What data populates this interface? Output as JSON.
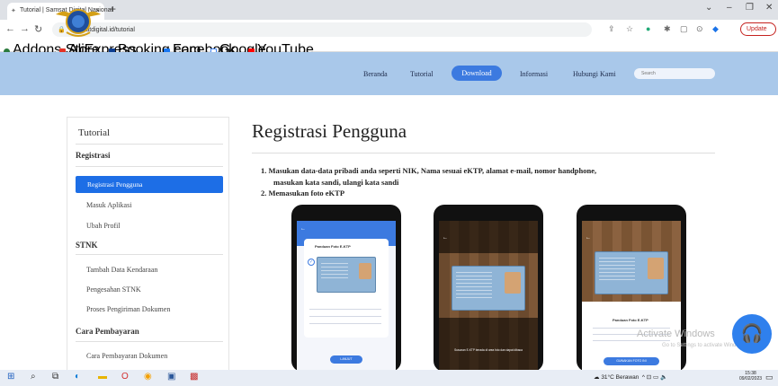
{
  "browser": {
    "tab_title": "Tutorial | Samsat Digital Nasional",
    "url": "samsatdigital.id/tutorial",
    "update_label": "Update",
    "bookmarks": [
      "Addons Store",
      "AliExpress",
      "Booking.com",
      "Facebook",
      "Google",
      "YouTube"
    ]
  },
  "site": {
    "nav": [
      "Beranda",
      "Tutorial",
      "Download",
      "Informasi",
      "Hubungi Kami"
    ],
    "active_nav": "Download",
    "search_placeholder": "Search"
  },
  "sidebar": {
    "title": "Tutorial",
    "sections": [
      {
        "heading": "Registrasi",
        "items": [
          "Registrasi Pengguna",
          "Masuk Aplikasi",
          "Ubah Profil"
        ]
      },
      {
        "heading": "STNK",
        "items": [
          "Tambah Data Kendaraan",
          "Pengesahan STNK",
          "Proses Pengiriman Dokumen"
        ]
      },
      {
        "heading": "Cara Pembayaran",
        "items": [
          "Cara Pembayaran Dokumen"
        ]
      }
    ],
    "active_item": "Registrasi Pengguna"
  },
  "main": {
    "title": "Registrasi Pengguna",
    "steps": [
      "1. Masukan data-data pribadi anda seperti NIK, Nama sesuai eKTP, alamat e-mail, nomor handphone,",
      "masukan kata sandi, ulangi kata sandi",
      "2. Memasukan foto eKTP"
    ],
    "phones": [
      {
        "heading": "Panduan Foto E-KTP",
        "button": "LANJUT"
      },
      {
        "caption": "Susunan E-KTP berada di area foto dan dapat dibaca"
      },
      {
        "heading": "Panduan Foto E-KTP",
        "button": "GUNAKAN FOTO INI"
      }
    ]
  },
  "overlay": {
    "watermark": "Activate Windows",
    "watermark_sub": "Go to Settings to activate Windows."
  },
  "taskbar": {
    "weather": "31°C Berawan",
    "time": "15:38",
    "date": "09/02/2023"
  },
  "colors": {
    "accent": "#1d6ee6",
    "header": "#a9c8ea",
    "nav_button": "#3c7ae0"
  }
}
